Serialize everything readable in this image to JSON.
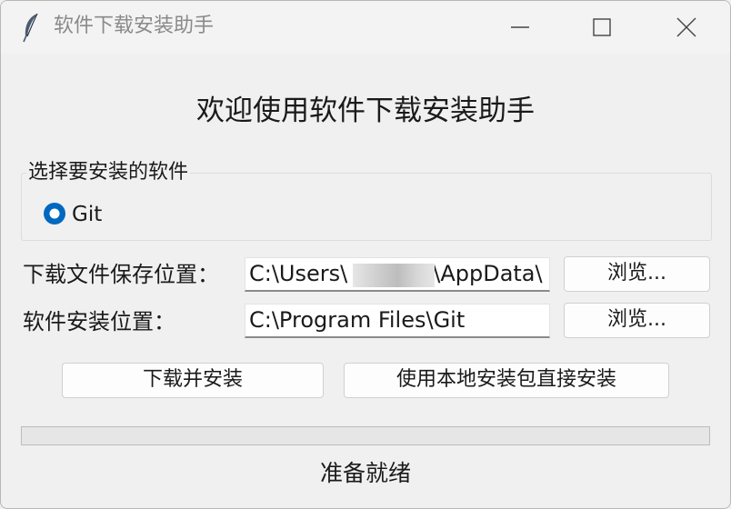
{
  "window": {
    "title": "软件下载安装助手",
    "app_icon": "feather-icon",
    "controls": [
      "minimize-icon",
      "maximize-icon",
      "close-icon"
    ]
  },
  "main": {
    "heading": "欢迎使用软件下载安装助手"
  },
  "software_group": {
    "legend": "选择要安装的软件",
    "options": [
      {
        "label": "Git",
        "selected": true
      }
    ]
  },
  "paths": {
    "save_label": "下载文件保存位置：",
    "save_value_prefix": "C:\\Users\\",
    "save_value_suffix": "\\AppData\\",
    "install_label": "软件安装位置：",
    "install_value": "C:\\Program Files\\Git",
    "browse_label": "浏览..."
  },
  "actions": {
    "download_install": "下载并安装",
    "local_install": "使用本地安装包直接安装"
  },
  "progress": {
    "value": 0
  },
  "status": {
    "text": "准备就绪"
  },
  "colors": {
    "accent": "#0067c0",
    "background": "#f0f0f0"
  }
}
